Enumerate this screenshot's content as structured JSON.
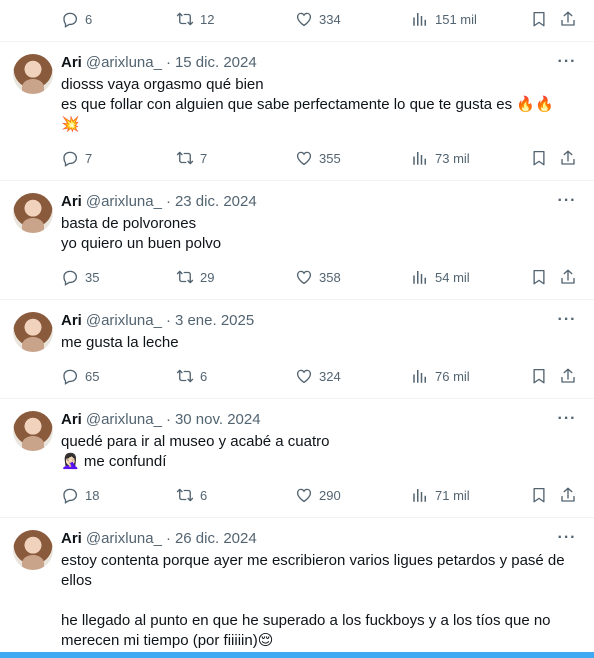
{
  "top_actions": {
    "replies": "6",
    "retweets": "12",
    "likes": "334",
    "views": "151 mil"
  },
  "tweets": [
    {
      "name": "Ari",
      "handle": "@arixluna_",
      "date": "15 dic. 2024",
      "lines": [
        "diosss vaya orgasmo qué bien",
        "es que follar con alguien que sabe perfectamente lo que te gusta es 🔥🔥",
        "💥"
      ],
      "replies": "7",
      "retweets": "7",
      "likes": "355",
      "views": "73 mil"
    },
    {
      "name": "Ari",
      "handle": "@arixluna_",
      "date": "23 dic. 2024",
      "lines": [
        "basta de polvorones",
        "yo quiero un buen polvo"
      ],
      "replies": "35",
      "retweets": "29",
      "likes": "358",
      "views": "54 mil"
    },
    {
      "name": "Ari",
      "handle": "@arixluna_",
      "date": "3 ene. 2025",
      "lines": [
        "me gusta la leche"
      ],
      "replies": "65",
      "retweets": "6",
      "likes": "324",
      "views": "76 mil"
    },
    {
      "name": "Ari",
      "handle": "@arixluna_",
      "date": "30 nov. 2024",
      "lines": [
        "quedé para ir al museo y acabé a cuatro",
        "🤦🏻‍♀️ me confundí"
      ],
      "replies": "18",
      "retweets": "6",
      "likes": "290",
      "views": "71 mil"
    },
    {
      "name": "Ari",
      "handle": "@arixluna_",
      "date": "26 dic. 2024",
      "lines": [
        "estoy contenta porque ayer me escribieron varios ligues petardos y pasé de ellos",
        "",
        "he llegado al punto en que he superado  a los fuckboys y a los tíos que no merecen mi tiempo (por fiiiiin)😌"
      ]
    }
  ],
  "dot": "·",
  "more_glyph": "···",
  "icons": [
    "reply-icon",
    "retweet-icon",
    "like-icon",
    "views-icon",
    "bookmark-icon",
    "share-icon",
    "more-icon"
  ],
  "colors": {
    "text": "#0f1419",
    "muted": "#536471",
    "divider": "#eff3f4",
    "accent": "#1d9bf0"
  }
}
